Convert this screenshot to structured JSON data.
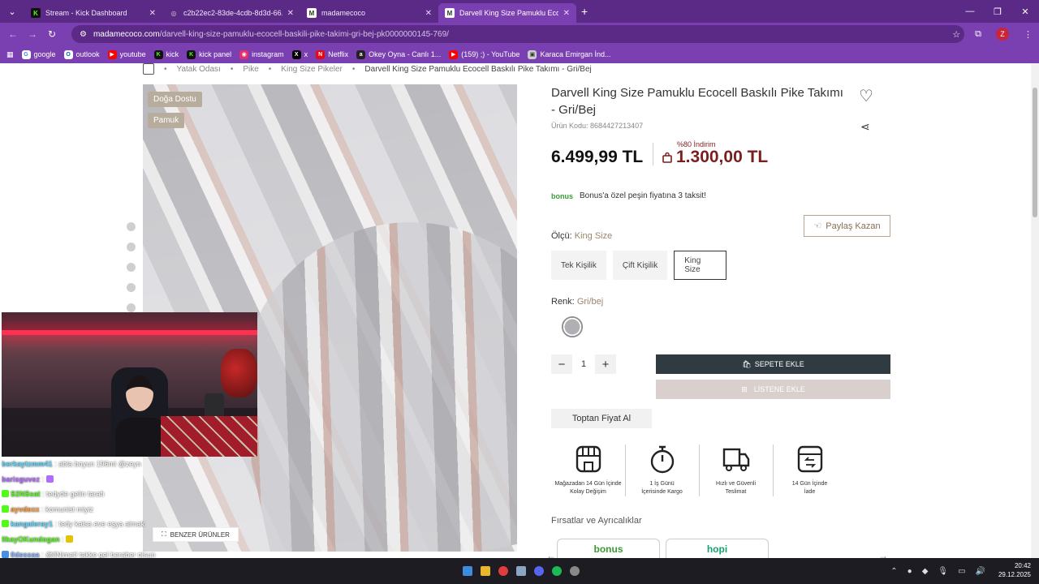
{
  "browser": {
    "tabs": [
      {
        "title": "Stream - Kick Dashboard",
        "icon": "kick-icon",
        "color": "#53fc18"
      },
      {
        "title": "c2b22ec2-83de-4cdb-8d3d-66...",
        "icon": "globe-icon",
        "color": "#888888"
      },
      {
        "title": "madamecoco",
        "icon": "madamecoco-icon",
        "color": "#ffffff"
      },
      {
        "title": "Darvell King Size Pamuklu Ecoc",
        "icon": "madamecoco-icon",
        "color": "#ffffff"
      }
    ],
    "url_domain": "madamecoco.com",
    "url_path": "/darvell-king-size-pamuklu-ecocell-baskili-pike-takimi-gri-bej-pk0000000145-769/",
    "profile_initial": "Z",
    "bookmarks": [
      {
        "label": "google",
        "icon": "google-icon",
        "color": "#ffffff"
      },
      {
        "label": "outlook",
        "icon": "outlook-icon",
        "color": "#ffffff"
      },
      {
        "label": "youtube",
        "icon": "youtube-icon",
        "color": "#ff0000"
      },
      {
        "label": "kick",
        "icon": "kick-icon",
        "color": "#53fc18"
      },
      {
        "label": "kick panel",
        "icon": "kick-icon",
        "color": "#53fc18"
      },
      {
        "label": "instagram",
        "icon": "instagram-icon",
        "color": "#e1306c"
      },
      {
        "label": "x",
        "icon": "x-icon",
        "color": "#000000"
      },
      {
        "label": "Netflix",
        "icon": "netflix-icon",
        "color": "#e50914"
      },
      {
        "label": "Okey Oyna - Canlı 1...",
        "icon": "okey-icon",
        "color": "#222222"
      },
      {
        "label": "(159) ;) - YouTube",
        "icon": "youtube-icon",
        "color": "#ff0000"
      },
      {
        "label": "Karaca Emirgan İnd...",
        "icon": "karaca-icon",
        "color": "#cccccc"
      }
    ]
  },
  "breadcrumbs": [
    "Yatak Odası",
    "Pike",
    "King Size Pikeler",
    "Darvell King Size Pamuklu Ecocell Baskılı Pike Takımı - Gri/Bej"
  ],
  "gallery": {
    "badges": [
      "Doğa Dostu",
      "Pamuk"
    ],
    "similar_label": "BENZER ÜRÜNLER"
  },
  "product": {
    "title": "Darvell King Size Pamuklu Ecocell Baskılı Pike Takımı - Gri/Bej",
    "code": "Ürün Kodu: 8684427213407",
    "price": "6.499,99 TL",
    "discount_label": "%80 İndirim",
    "discount_price": "1.300,00 TL",
    "bonus_logo": "bonus",
    "bonus_text": "Bonus'a özel peşin fiyatına 3 taksit!",
    "share_earn": "Paylaş Kazan",
    "size_label": "Ölçü:",
    "size_value": "King Size",
    "sizes": [
      "Tek Kişilik",
      "Çift Kişilik",
      "King Size"
    ],
    "color_label": "Renk:",
    "color_value": "Gri/bej",
    "quantity": "1",
    "add_to_cart": "SEPETE EKLE",
    "add_to_list": "LİSTENE EKLE",
    "wholesale": "Toptan Fiyat Al",
    "features": [
      {
        "line1": "Mağazadan 14 Gün İçinde",
        "line2": "Kolay Değişim",
        "icon": "store-icon"
      },
      {
        "line1": "1 İş Günü",
        "line2": "İçerisinde Kargo",
        "icon": "stopwatch-icon"
      },
      {
        "line1": "Hızlı ve Güvenli",
        "line2": "Teslimat",
        "icon": "truck-icon"
      },
      {
        "line1": "14 Gün İçinde",
        "line2": "İade",
        "icon": "return-box-icon"
      }
    ],
    "opportunities_title": "Fırsatlar ve Ayrıcalıklar",
    "promos": [
      "bonus",
      "hopi"
    ]
  },
  "chat": [
    {
      "user": "berkaytzmm41",
      "color": "#5ad6ff",
      "msg": ": abla boyun 196mi @zeyn"
    },
    {
      "user": "barisguvez",
      "color": "#b06cff",
      "msg": ":"
    },
    {
      "user": "S2NSsat",
      "color": "#53fc18",
      "msg": ": tedyde gelin tarafı"
    },
    {
      "user": "ayvdexx",
      "color": "#ff9a3c",
      "msg": ": komunist miyiz"
    },
    {
      "user": "kangaleray1",
      "color": "#5ad6ff",
      "msg": ": tedy kalsa eve eşya almak"
    },
    {
      "user": "IlkayOKundogan",
      "color": "#53fc18",
      "msg": ":"
    },
    {
      "user": "0dessaa",
      "color": "#8ab4ff",
      "msg": ": @llNimetI takke gel beraber olsun"
    }
  ],
  "taskbar": {
    "time": "20:42",
    "date": "29.12.2025"
  }
}
